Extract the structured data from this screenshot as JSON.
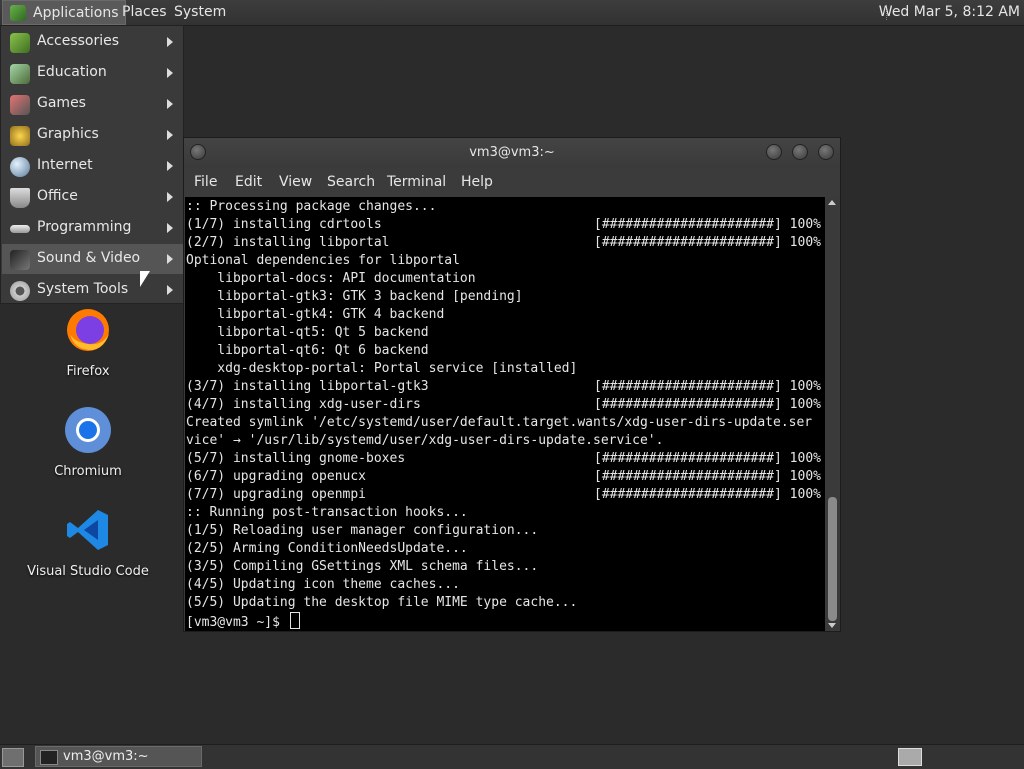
{
  "top_panel": {
    "applications": "Applications",
    "places": "Places",
    "system": "System",
    "clock": "Wed Mar 5,  8:12 AM"
  },
  "app_menu": {
    "items": [
      {
        "label": "Accessories",
        "icon": "accessories-icon"
      },
      {
        "label": "Education",
        "icon": "education-icon"
      },
      {
        "label": "Games",
        "icon": "games-icon"
      },
      {
        "label": "Graphics",
        "icon": "graphics-icon"
      },
      {
        "label": "Internet",
        "icon": "internet-icon"
      },
      {
        "label": "Office",
        "icon": "office-icon"
      },
      {
        "label": "Programming",
        "icon": "programming-icon"
      },
      {
        "label": "Sound & Video",
        "icon": "sound-video-icon"
      },
      {
        "label": "System Tools",
        "icon": "system-tools-icon"
      }
    ],
    "hovered": "Sound & Video"
  },
  "desktop": {
    "icons": [
      {
        "label": "Firefox"
      },
      {
        "label": "Chromium"
      },
      {
        "label": "Visual Studio Code"
      }
    ]
  },
  "terminal": {
    "title": "vm3@vm3:~",
    "menu": [
      "File",
      "Edit",
      "View",
      "Search",
      "Terminal",
      "Help"
    ],
    "lines": [
      {
        "text": ":: Processing package changes...",
        "right": ""
      },
      {
        "text": "(1/7) installing cdrtools",
        "right": "[######################] 100%"
      },
      {
        "text": "(2/7) installing libportal",
        "right": "[######################] 100%"
      },
      {
        "text": "Optional dependencies for libportal",
        "right": ""
      },
      {
        "text": "    libportal-docs: API documentation",
        "right": ""
      },
      {
        "text": "    libportal-gtk3: GTK 3 backend [pending]",
        "right": ""
      },
      {
        "text": "    libportal-gtk4: GTK 4 backend",
        "right": ""
      },
      {
        "text": "    libportal-qt5: Qt 5 backend",
        "right": ""
      },
      {
        "text": "    libportal-qt6: Qt 6 backend",
        "right": ""
      },
      {
        "text": "    xdg-desktop-portal: Portal service [installed]",
        "right": ""
      },
      {
        "text": "(3/7) installing libportal-gtk3",
        "right": "[######################] 100%"
      },
      {
        "text": "(4/7) installing xdg-user-dirs",
        "right": "[######################] 100%"
      },
      {
        "text": "Created symlink '/etc/systemd/user/default.target.wants/xdg-user-dirs-update.ser",
        "right": ""
      },
      {
        "text": "vice' → '/usr/lib/systemd/user/xdg-user-dirs-update.service'.",
        "right": ""
      },
      {
        "text": "(5/7) installing gnome-boxes",
        "right": "[######################] 100%"
      },
      {
        "text": "(6/7) upgrading openucx",
        "right": "[######################] 100%"
      },
      {
        "text": "(7/7) upgrading openmpi",
        "right": "[######################] 100%"
      },
      {
        "text": ":: Running post-transaction hooks...",
        "right": ""
      },
      {
        "text": "(1/5) Reloading user manager configuration...",
        "right": ""
      },
      {
        "text": "(2/5) Arming ConditionNeedsUpdate...",
        "right": ""
      },
      {
        "text": "(3/5) Compiling GSettings XML schema files...",
        "right": ""
      },
      {
        "text": "(4/5) Updating icon theme caches...",
        "right": ""
      },
      {
        "text": "(5/5) Updating the desktop file MIME type cache...",
        "right": ""
      }
    ],
    "prompt": "[vm3@vm3 ~]$ "
  },
  "bottom_panel": {
    "task_label": "vm3@vm3:~"
  }
}
